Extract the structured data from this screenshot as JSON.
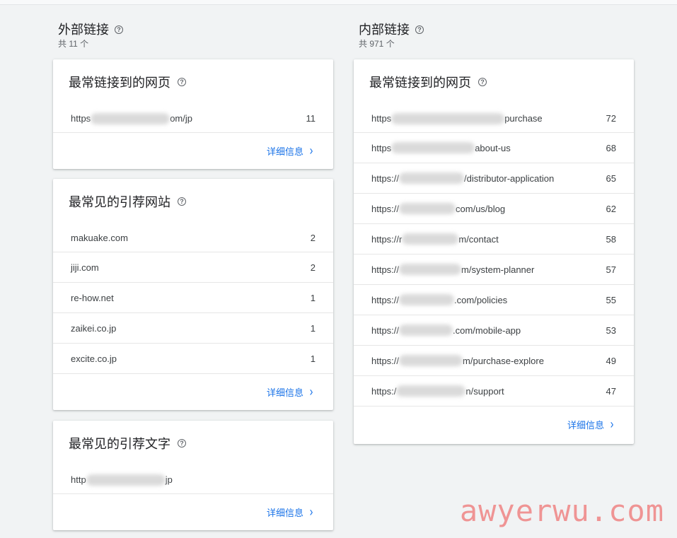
{
  "external": {
    "title": "外部链接",
    "subtitle": "共 11 个",
    "top_pages": {
      "title": "最常链接到的网页",
      "rows": [
        {
          "prefix": "https",
          "suffix": "om/jp",
          "count": "11"
        }
      ],
      "details": "详细信息"
    },
    "top_sites": {
      "title": "最常见的引荐网站",
      "rows": [
        {
          "label": "makuake.com",
          "count": "2"
        },
        {
          "label": "jiji.com",
          "count": "2"
        },
        {
          "label": "re-how.net",
          "count": "1"
        },
        {
          "label": "zaikei.co.jp",
          "count": "1"
        },
        {
          "label": "excite.co.jp",
          "count": "1"
        }
      ],
      "details": "详细信息"
    },
    "top_text": {
      "title": "最常见的引荐文字",
      "rows": [
        {
          "prefix": "http",
          "suffix": "jp"
        }
      ],
      "details": "详细信息"
    }
  },
  "internal": {
    "title": "内部链接",
    "subtitle": "共 971 个",
    "top_pages": {
      "title": "最常链接到的网页",
      "rows": [
        {
          "prefix": "https",
          "suffix": "purchase",
          "count": "72"
        },
        {
          "prefix": "https",
          "suffix": "about-us",
          "count": "68"
        },
        {
          "prefix": "https://",
          "suffix": "/distributor-application",
          "count": "65"
        },
        {
          "prefix": "https://",
          "suffix": "com/us/blog",
          "count": "62"
        },
        {
          "prefix": "https://r",
          "suffix": "m/contact",
          "count": "58"
        },
        {
          "prefix": "https://",
          "suffix": "m/system-planner",
          "count": "57"
        },
        {
          "prefix": "https://",
          "suffix": ".com/policies",
          "count": "55"
        },
        {
          "prefix": "https://",
          "suffix": ".com/mobile-app",
          "count": "53"
        },
        {
          "prefix": "https://",
          "suffix": "m/purchase-explore",
          "count": "49"
        },
        {
          "prefix": "https:/",
          "suffix": "n/support",
          "count": "47"
        }
      ],
      "details": "详细信息"
    }
  },
  "watermark": "awyerwu.com",
  "icons": {
    "help": "?",
    "chevron": "›"
  },
  "colors": {
    "link": "#1a73e8",
    "background": "#f1f3f4",
    "watermark": "#ef8a8a"
  }
}
